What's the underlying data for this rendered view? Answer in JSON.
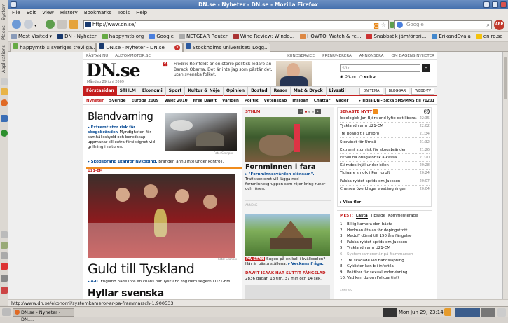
{
  "gnome_panel": {
    "applications": "Applications",
    "places": "Places",
    "system": "System"
  },
  "window": {
    "title": "DN.se - Nyheter - DN.se - Mozilla Firefox"
  },
  "menu": [
    "File",
    "Edit",
    "View",
    "History",
    "Bookmarks",
    "Tools",
    "Help"
  ],
  "nav": {
    "url": "http://www.dn.se/",
    "search_placeholder": "Google"
  },
  "bookmarks": [
    "Most Visited",
    "DN - Nyheter",
    "happymtb.org",
    "Google",
    "NETGEAR Router",
    "Wine Review: Windo...",
    "HOWTO: Watch & re...",
    "Snabbsök jämförpri...",
    "ErikandSvala",
    "eniro.se"
  ],
  "tabs": [
    "happymtb :: sveriges trevliga...",
    "DN.se - Nyheter - DN.se",
    "Stockholms universitet: Logg..."
  ],
  "site": {
    "toplinks": [
      "PÅSTAN.NU",
      "ALLTOMMOTOR.SE"
    ],
    "toplinks_right": [
      "KUNDSERVICE",
      "PRENUMERERA",
      "ANNONSERA",
      "OM DAGENS NYHETER"
    ],
    "logo": "DN.se",
    "date": "Måndag 29 juni 2009",
    "quote": "Fredrik Reinfeldt är en större politisk ledare än Barack Obama. Det är inte jag som påstår det, utan svenska folket.",
    "search_placeholder": "Sök...",
    "search_opt1": "DN.se",
    "search_opt2": "eniro",
    "nav_main": [
      "Förstasidan",
      "STHLM",
      "Ekonomi",
      "Sport",
      "Kultur & Nöje",
      "Opinion",
      "Bostad",
      "Resor",
      "Mat & Dryck",
      "Livsstil"
    ],
    "nav_right": [
      "DN TEMA",
      "BLOGGAR",
      "WEBB-TV"
    ],
    "nav_sub": [
      "Nyheter",
      "Sverige",
      "Europa 2009",
      "Valet 2010",
      "Free Dawit",
      "Världen",
      "Politik",
      "Vetenskap",
      "Insidan",
      "Chattar",
      "Väder"
    ],
    "tipsa": "▸ Tipsa DN - Sicka SMS/MMS till 71201",
    "col1": {
      "head1": "Blandvarning",
      "item1_link": "▸ Extremt stor risk för skogsbränder.",
      "item1_text": "Myndigheten för samhällsskydd och beredskap uppmanar till extra försiktighet vid grillning i naturen.",
      "item2_link": "▸ Skogsbrand utanför Nyköping.",
      "item2_text": "Branden ännu inte under kontroll.",
      "photo_credit1": "Foto: Scanpix",
      "section": "U21-EM",
      "photo_credit2": "Foto: Scanpix",
      "big_head": "Guld till Tyskland",
      "lead_link": "▸ 4-0.",
      "lead_text": "England hade inte en chans när Tyskland tog hem segern i U21-EM.",
      "head2": "Hyllar svenska"
    },
    "col2": {
      "section": "STHLM",
      "head": "Fornminnen i fara",
      "link": "▸ \"Fornminnesvården olönsam\".",
      "text": "Trafikkontoret vill lägga ned fornminnesgruppen som röjer kring runor och rösen.",
      "ad": "ANNONS",
      "pastan_tag": "PÅ STAN",
      "pastan_text": "Sugen på en kall i kvällssolen? Här är bästa ställena.",
      "pastan_link": "▸ Veckans fråga.",
      "deal_head": "DAWIT ISAAK HAR SUTTIT FÄNGSLAD",
      "deal_text": "2836 dagar, 13 tim, 37 min och 14 sek."
    },
    "latest": {
      "title": "SENASTE NYTT",
      "items": [
        {
          "t": "Ideologisk Jan Björklund lyfte det liberala",
          "time": "22:35"
        },
        {
          "t": "Tyskland vann U21-EM",
          "time": "22:02"
        },
        {
          "t": "Tre poäng till Örebro",
          "time": "21:34"
        },
        {
          "t": "Storvinst för Umeå",
          "time": "21:32"
        },
        {
          "t": "Extremt stor risk för skogsbränder",
          "time": "21:26"
        },
        {
          "t": "FP vill ha obligatorisk a-kassa",
          "time": "21:20"
        },
        {
          "t": "Klämdes ihjäl under bilen",
          "time": "20:28"
        },
        {
          "t": "Tidigare smolk i Pen Idroft",
          "time": "20:24"
        },
        {
          "t": "Falska ryktet sprids om Jackson",
          "time": "20:07"
        },
        {
          "t": "Chelsea överklagar avstängningar",
          "time": "20:04"
        }
      ],
      "more": "▸ Visa fler"
    },
    "most": {
      "title": "MEST:",
      "tabs": [
        "Lästa",
        "Tipsade",
        "Kommenterade"
      ],
      "items": [
        "Billig kamera den bästa",
        "Hedman åtalas för dopingstrott",
        "Madoff dömd till 150 års fängelse",
        "Falska ryktet sprids om Jackson",
        "Tyskland vann U21-EM",
        "Systemkameror är på frammarsch",
        "Tre skadade vid bandsläpning",
        "Cyklister kan bli infertila",
        "Politiker får sexualundervisning",
        "Vad kan du om Folkpartiet?"
      ]
    },
    "ad_right": "ANNONS"
  },
  "status": "http://www.dn.se/ekonomi/systemkameror-ar-pa-frammarsch-1.900533",
  "taskbar": {
    "task": "DN.se - Nyheter - DN....",
    "clock": "Mon Jun 29, 23:14"
  },
  "colors": {
    "dn_red": "#c41e1e",
    "link": "#0b4d96",
    "title_blue": "#4470ad"
  }
}
